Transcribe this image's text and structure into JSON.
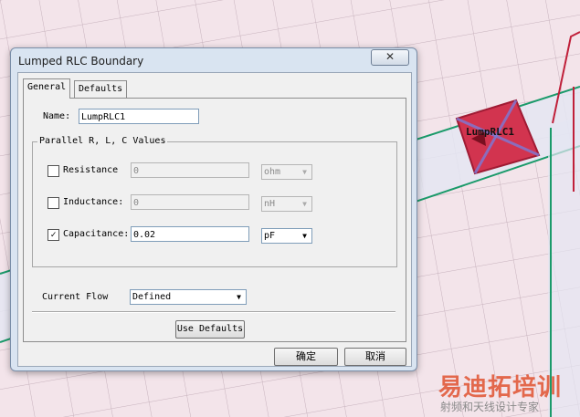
{
  "dialog": {
    "title": "Lumped RLC Boundary",
    "close_label": "✕"
  },
  "tabs": [
    {
      "label": "General",
      "active": true
    },
    {
      "label": "Defaults",
      "active": false
    }
  ],
  "name": {
    "label": "Name:",
    "value": "LumpRLC1"
  },
  "group": {
    "title": "Parallel R, L, C Values",
    "resistance": {
      "label": "Resistance",
      "checked": false,
      "value": "0",
      "unit": "ohm"
    },
    "inductance": {
      "label": "Inductance:",
      "checked": false,
      "value": "0",
      "unit": "nH"
    },
    "capacitance": {
      "label": "Capacitance:",
      "checked": true,
      "check_mark": "✓",
      "value": "0.02",
      "unit": "pF"
    }
  },
  "current_flow": {
    "label": "Current Flow",
    "value": "Defined"
  },
  "buttons": {
    "use_defaults": "Use Defaults",
    "ok": "确定",
    "cancel": "取消"
  },
  "canvas": {
    "component_label": "LumpRLC1",
    "accent_green": "#1a9a6a",
    "accent_red": "#c0203a"
  },
  "watermark": {
    "brand": "易迪拓培训",
    "subtitle": "射频和天线设计专家"
  }
}
